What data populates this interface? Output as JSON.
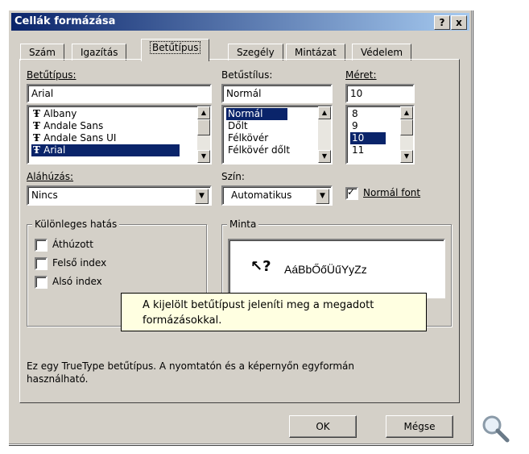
{
  "window": {
    "title": "Cellák formázása",
    "help_btn": "?",
    "close_btn": "x"
  },
  "tabs": [
    {
      "label": "Szám"
    },
    {
      "label": "Igazítás"
    },
    {
      "label": "Betűtípus"
    },
    {
      "label": "Szegély"
    },
    {
      "label": "Mintázat"
    },
    {
      "label": "Védelem"
    }
  ],
  "font": {
    "label": "Betűtípus:",
    "value": "Arial",
    "list": [
      "Albany",
      "Andale Sans",
      "Andale Sans UI",
      "Arial"
    ],
    "selected": "Arial"
  },
  "style": {
    "label": "Betűstílus:",
    "value": "Normál",
    "list": [
      "Normál",
      "Dőlt",
      "Félkövér",
      "Félkövér dőlt"
    ],
    "selected": "Normál"
  },
  "size": {
    "label": "Méret:",
    "value": "10",
    "list": [
      "8",
      "9",
      "10",
      "11"
    ],
    "selected": "10"
  },
  "underline": {
    "label": "Aláhúzás:",
    "value": "Nincs"
  },
  "color": {
    "label": "Szín:",
    "value": "Automatikus"
  },
  "normal_font": {
    "label": "Normál font",
    "checked": true
  },
  "effects": {
    "title": "Különleges hatás",
    "items": [
      {
        "label": "Áthúzott",
        "checked": false
      },
      {
        "label": "Felső index",
        "checked": false
      },
      {
        "label": "Alsó index",
        "checked": false
      }
    ]
  },
  "preview": {
    "title": "Minta",
    "sample": "AáBbŐőÜűYyZz"
  },
  "tooltip": {
    "line1": "A kijelölt betűtípust jeleníti meg a megadott",
    "line2": "formázásokkal."
  },
  "info": {
    "line1": "Ez egy TrueType betűtípus. A nyomtatón és a képernyőn egyformán",
    "line2": "használható."
  },
  "buttons": {
    "ok": "OK",
    "cancel": "Mégse"
  },
  "icons": {
    "font_type": "truetype-icon",
    "zoom": "magnifier-icon"
  }
}
